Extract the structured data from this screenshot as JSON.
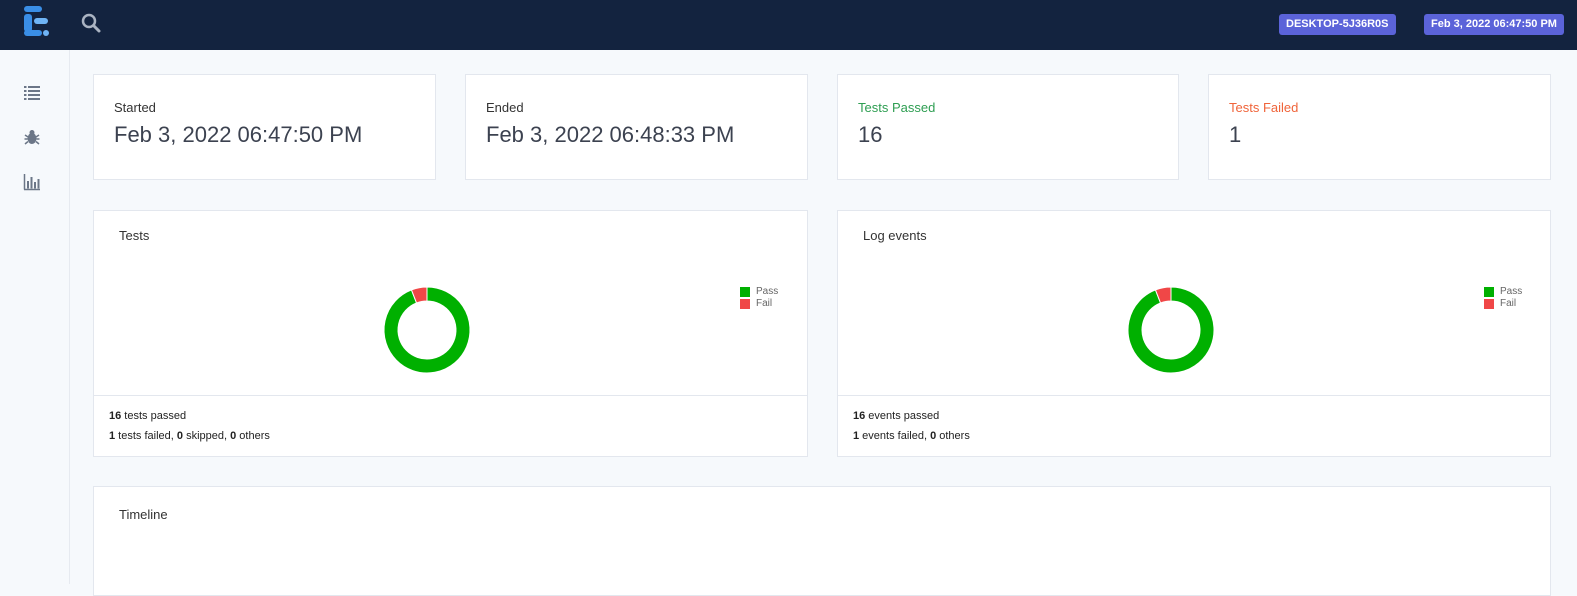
{
  "header": {
    "host_badge": "DESKTOP-5J36R0S",
    "date_badge": "Feb 3, 2022 06:47:50 PM"
  },
  "sidebar": {
    "items": [
      {
        "icon": "list-icon"
      },
      {
        "icon": "bug-icon"
      },
      {
        "icon": "bar-chart-icon"
      }
    ]
  },
  "stats": {
    "started": {
      "label": "Started",
      "value": "Feb 3, 2022 06:47:50 PM"
    },
    "ended": {
      "label": "Ended",
      "value": "Feb 3, 2022 06:48:33 PM"
    },
    "passed": {
      "label": "Tests Passed",
      "value": "16"
    },
    "failed": {
      "label": "Tests Failed",
      "value": "1"
    }
  },
  "colors": {
    "pass": "#00b000",
    "fail": "#f04747",
    "badge": "#5b63d9",
    "topbar": "#13233f"
  },
  "tests_card": {
    "title": "Tests",
    "footer": {
      "passed_count": "16",
      "passed_text": " tests passed",
      "failed_count": "1",
      "failed_text": " tests failed, ",
      "skipped_count": "0",
      "skipped_text": " skipped, ",
      "others_count": "0",
      "others_text": " others"
    }
  },
  "events_card": {
    "title": "Log events",
    "footer": {
      "passed_count": "16",
      "passed_text": " events passed",
      "failed_count": "1",
      "failed_text": " events failed, ",
      "others_count": "0",
      "others_text": " others"
    }
  },
  "timeline": {
    "title": "Timeline"
  },
  "chart_data": [
    {
      "type": "pie",
      "title": "Tests",
      "categories": [
        "Pass",
        "Fail"
      ],
      "values": [
        16,
        1
      ],
      "legend": "right"
    },
    {
      "type": "pie",
      "title": "Log events",
      "categories": [
        "Pass",
        "Fail"
      ],
      "values": [
        16,
        1
      ],
      "legend": "right"
    }
  ]
}
